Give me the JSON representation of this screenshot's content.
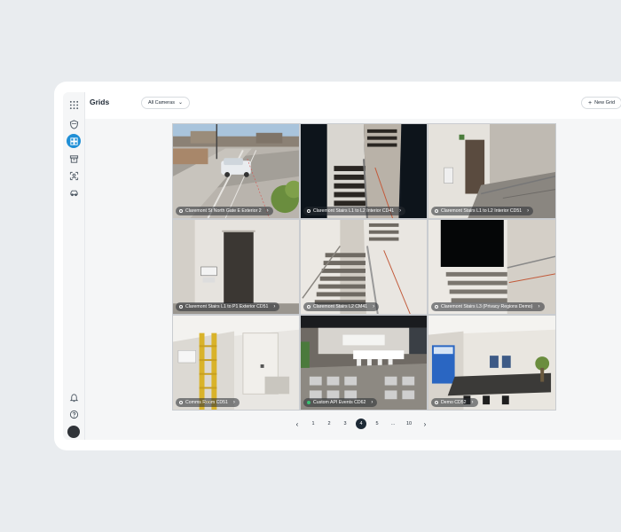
{
  "header": {
    "title": "Grids",
    "filter_label": "All Cameras",
    "new_grid_label": "New Grid"
  },
  "sidebar": {
    "items": [
      {
        "icon": "apps-grid-icon"
      },
      {
        "icon": "shield-icon"
      },
      {
        "icon": "grid-view-icon",
        "active": true
      },
      {
        "icon": "archive-icon"
      },
      {
        "icon": "people-icon"
      },
      {
        "icon": "vehicle-icon"
      }
    ],
    "bottom": [
      {
        "icon": "bell-icon"
      },
      {
        "icon": "help-icon"
      },
      {
        "icon": "avatar"
      }
    ]
  },
  "cameras": [
    {
      "label": "Claremont St North Gate E Exterior 2",
      "status": "online"
    },
    {
      "label": "Claremont Stairs L1 to L2 Interior CD41",
      "status": "online"
    },
    {
      "label": "Claremont Stairs L1 to L2 Interior CD51",
      "status": "online"
    },
    {
      "label": "Claremont Stairs L1 to P1 Exterior CD51",
      "status": "online"
    },
    {
      "label": "Claremont Stairs L2 CM41",
      "status": "online"
    },
    {
      "label": "Claremont Stairs L3 (Privacy Regions Demo)",
      "status": "online"
    },
    {
      "label": "Comms Room CD51",
      "status": "online"
    },
    {
      "label": "Custom API Events CD62",
      "status": "live"
    },
    {
      "label": "Demo CD52",
      "status": "online"
    }
  ],
  "pagination": {
    "pages": [
      "1",
      "2",
      "3",
      "4",
      "5",
      "...",
      "10"
    ],
    "current": "4"
  },
  "colors": {
    "accent": "#1f8fd6",
    "active_page": "#1d2a36",
    "background": "#e9ecef"
  }
}
